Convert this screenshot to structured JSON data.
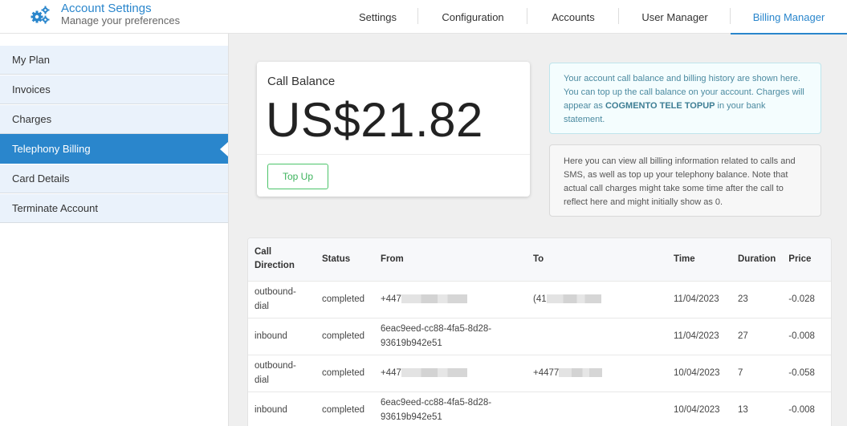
{
  "header": {
    "icon": "gears-icon",
    "title": "Account Settings",
    "subtitle": "Manage your preferences",
    "tabs": [
      {
        "label": "Settings",
        "active": false
      },
      {
        "label": "Configuration",
        "active": false
      },
      {
        "label": "Accounts",
        "active": false
      },
      {
        "label": "User Manager",
        "active": false
      },
      {
        "label": "Billing Manager",
        "active": true
      }
    ],
    "accent_color": "#2a86cc"
  },
  "sidebar": {
    "items": [
      {
        "label": "My Plan",
        "active": false
      },
      {
        "label": "Invoices",
        "active": false
      },
      {
        "label": "Charges",
        "active": false
      },
      {
        "label": "Telephony Billing",
        "active": true
      },
      {
        "label": "Card Details",
        "active": false
      },
      {
        "label": "Terminate Account",
        "active": false
      }
    ]
  },
  "balance": {
    "label": "Call Balance",
    "value": "US$21.82",
    "topup_label": "Top Up",
    "topup_color": "#3cb35c"
  },
  "info": {
    "blue_before": "Your account call balance and billing history are shown here. You can top up the call balance on your account. Charges will appear as ",
    "blue_bold": "COGMENTO TELE TOPUP",
    "blue_after": " in your bank statement.",
    "grey": "Here you can view all billing information related to calls and SMS, as well as top up your telephony balance. Note that actual call charges might take some time after the call to reflect here and might initially show as 0."
  },
  "table": {
    "headers": [
      "Call Direction",
      "Status",
      "From",
      "To",
      "Time",
      "Duration",
      "Price"
    ],
    "rows": [
      {
        "direction": "outbound-dial",
        "status": "completed",
        "from": "+447",
        "from_masked": true,
        "to": "(41",
        "to_masked": true,
        "time": "11/04/2023",
        "duration": "23",
        "price": "-0.028"
      },
      {
        "direction": "inbound",
        "status": "completed",
        "from": "6eac9eed-cc88-4fa5-8d28-93619b942e51",
        "from_masked": false,
        "to": "",
        "to_masked": false,
        "time": "11/04/2023",
        "duration": "27",
        "price": "-0.008"
      },
      {
        "direction": "outbound-dial",
        "status": "completed",
        "from": "+447",
        "from_masked": true,
        "to": "+4477",
        "to_masked": true,
        "time": "10/04/2023",
        "duration": "7",
        "price": "-0.058"
      },
      {
        "direction": "inbound",
        "status": "completed",
        "from": "6eac9eed-cc88-4fa5-8d28-93619b942e51",
        "from_masked": false,
        "to": "",
        "to_masked": false,
        "time": "10/04/2023",
        "duration": "13",
        "price": "-0.008"
      }
    ]
  }
}
